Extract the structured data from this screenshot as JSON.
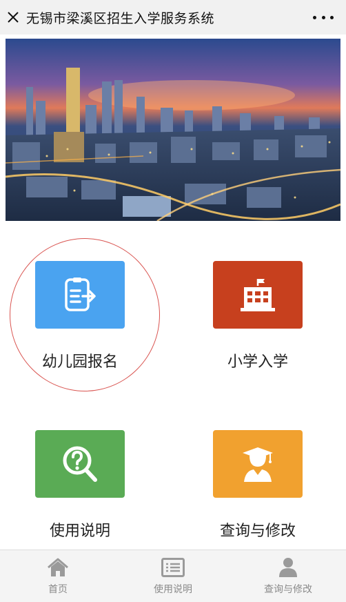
{
  "header": {
    "close_icon": "close-icon",
    "title": "无锡市梁溪区招生入学服务系统",
    "more_icon": "more-dots-icon"
  },
  "banner": {
    "description_icon": "city-night-skyline-image"
  },
  "menu": {
    "items": [
      {
        "label": "幼儿园报名",
        "icon": "form-arrow-icon",
        "color": "#4aa3f0",
        "highlighted": true
      },
      {
        "label": "小学入学",
        "icon": "school-building-icon",
        "color": "#c7401e"
      },
      {
        "label": "使用说明",
        "icon": "question-magnifier-icon",
        "color": "#5aab55"
      },
      {
        "label": "查询与修改",
        "icon": "graduate-icon",
        "color": "#f1a12f"
      }
    ]
  },
  "tabbar": {
    "items": [
      {
        "label": "首页",
        "icon": "home-icon"
      },
      {
        "label": "使用说明",
        "icon": "list-icon"
      },
      {
        "label": "查询与修改",
        "icon": "user-icon"
      }
    ]
  },
  "colors": {
    "highlight_circle": "#d9534f",
    "tab_icon": "#9a9a9a"
  }
}
